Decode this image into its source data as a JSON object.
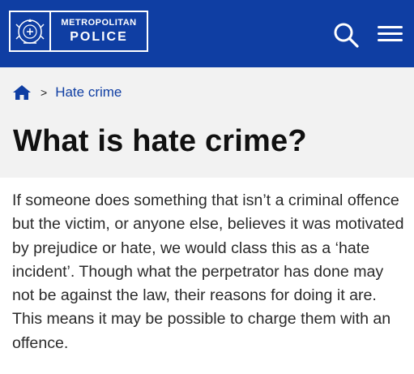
{
  "header": {
    "logo_line1": "METROPOLITAN",
    "logo_line2": "POLICE",
    "bg_color": "#0f3ea3",
    "search_icon": "search-icon",
    "menu_icon": "menu-icon"
  },
  "breadcrumb": {
    "home_icon": "home-icon",
    "separator": ">",
    "current": "Hate crime"
  },
  "page": {
    "title": "What is hate crime?",
    "paragraph": "If someone does something that isn’t a criminal offence but the victim, or anyone else, believes it was motivated by prejudice or hate, we would class this as a ‘hate incident’. Though what the perpetrator has done may not be against the law, their reasons for doing it are. This means it may be possible to charge them with an offence."
  }
}
